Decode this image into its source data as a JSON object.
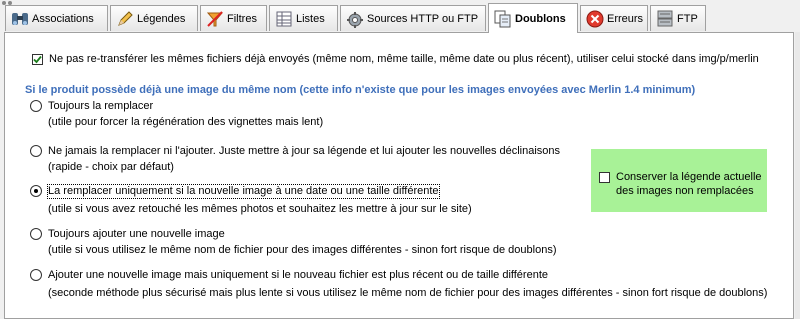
{
  "tabs": [
    {
      "label": "Associations",
      "icon": "binoculars-icon"
    },
    {
      "label": "Légendes",
      "icon": "pencil-icon"
    },
    {
      "label": "Filtres",
      "icon": "filter-icon"
    },
    {
      "label": "Listes",
      "icon": "list-icon"
    },
    {
      "label": "Sources HTTP ou FTP",
      "icon": "gear-icon"
    },
    {
      "label": "Doublons",
      "icon": "duplicate-icon"
    },
    {
      "label": "Erreurs",
      "icon": "error-icon"
    },
    {
      "label": "FTP",
      "icon": "ftp-server-icon"
    }
  ],
  "selected_tab": "Doublons",
  "no_retransfer": {
    "checked": true,
    "label": "Ne pas re-transférer les mêmes fichiers déjà envoyés (même nom, même taille, même date ou plus récent), utiliser celui stocké dans img/p/merlin"
  },
  "section_heading": "Si le produit possède déjà une image du même nom (cette info n'existe que pour les images envoyées avec Merlin 1.4 minimum)",
  "options": [
    {
      "label": "Toujours la remplacer",
      "desc": "(utile pour forcer la régénération des vignettes mais lent)",
      "selected": false
    },
    {
      "label": "Ne jamais la remplacer ni l'ajouter. Juste mettre à jour sa légende et lui ajouter les nouvelles déclinaisons",
      "desc": "(rapide - choix par défaut)",
      "selected": false
    },
    {
      "label": "La remplacer uniquement si la nouvelle image à une date ou une taille différente",
      "desc": "(utile si vous avez retouché les mêmes photos et souhaitez les mettre à jour sur le site)",
      "selected": true
    },
    {
      "label": "Toujours ajouter une nouvelle image",
      "desc": "(utile si vous utilisez le même nom de fichier pour des images différentes - sinon fort risque de doublons)",
      "selected": false
    },
    {
      "label": "Ajouter une nouvelle image mais uniquement si le nouveau fichier est plus récent ou de taille différente",
      "desc": "(seconde méthode plus sécurisé mais plus lente si vous utilisez le même nom de fichier pour des images différentes - sinon fort risque de doublons)",
      "selected": false
    }
  ],
  "keep_caption": {
    "checked": false,
    "label_line1": "Conserver la légende actuelle",
    "label_line2": "des images non remplacées"
  },
  "colors": {
    "heading": "#3f6fba",
    "green_box": "#a8f297",
    "checkbox_check": "#1c7d1c"
  }
}
